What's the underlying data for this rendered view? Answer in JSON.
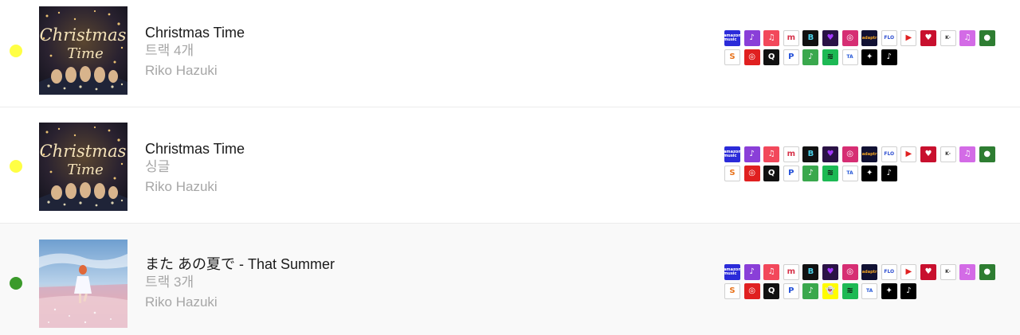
{
  "releases": [
    {
      "title": "Christmas Time",
      "subtitle": "트랙 4개",
      "artist": "Riko Hazuki",
      "status_color": "#ffff44",
      "cover": "christmas-cover",
      "cover_text": [
        "Christmas",
        "Time"
      ],
      "stores": [
        "amazon-music",
        "audiomack",
        "apple-music",
        "melon",
        "boomplay",
        "deezer",
        "instagram",
        "adaptr",
        "flo",
        "youtube-music",
        "iheartradio",
        "kkbox",
        "itunes",
        "napster",
        "anghami",
        "netease",
        "qobuz",
        "pandora",
        "jiosaavn",
        "spotify",
        "tidal-alt",
        "tidal",
        "tiktok"
      ]
    },
    {
      "title": "Christmas Time",
      "subtitle": "싱글",
      "artist": "Riko Hazuki",
      "status_color": "#ffff44",
      "cover": "christmas-cover",
      "cover_text": [
        "Christmas",
        "Time"
      ],
      "stores": [
        "amazon-music",
        "audiomack",
        "apple-music",
        "melon",
        "boomplay",
        "deezer",
        "instagram",
        "adaptr",
        "flo",
        "youtube-music",
        "iheartradio",
        "kkbox",
        "itunes",
        "napster",
        "anghami",
        "netease",
        "qobuz",
        "pandora",
        "jiosaavn",
        "spotify",
        "tidal-alt",
        "tidal",
        "tiktok"
      ]
    },
    {
      "title": "また あの夏で - That Summer",
      "subtitle": "트랙 3개",
      "artist": "Riko Hazuki",
      "status_color": "#3a9a2a",
      "cover": "summer-beach-cover",
      "stores": [
        "amazon-music",
        "audiomack",
        "apple-music",
        "melon",
        "boomplay",
        "deezer",
        "instagram",
        "adaptr",
        "flo",
        "youtube-music",
        "iheartradio",
        "kkbox",
        "itunes",
        "napster",
        "anghami",
        "netease",
        "qobuz",
        "pandora",
        "jiosaavn",
        "snapchat",
        "spotify",
        "tidal-alt",
        "tidal",
        "tiktok"
      ]
    }
  ],
  "store_styles": {
    "amazon-music": {
      "bg": "#2b2bd9",
      "fg": "#ffffff",
      "glyph": "amazon music",
      "cls": "xs"
    },
    "audiomack": {
      "bg": "#8a3fd8",
      "fg": "#ffffff",
      "glyph": "♪"
    },
    "apple-music": {
      "bg": "#f2485b",
      "fg": "#ffffff",
      "glyph": "♫"
    },
    "melon": {
      "bg": "#ffffff",
      "fg": "#d6334a",
      "glyph": "m",
      "border": true
    },
    "boomplay": {
      "bg": "#111111",
      "fg": "#4ad0e8",
      "glyph": "B"
    },
    "deezer": {
      "bg": "#2a1245",
      "fg": "#a238ff",
      "glyph": "♥"
    },
    "instagram": {
      "bg": "#d62e73",
      "fg": "#ffffff",
      "glyph": "◎"
    },
    "adaptr": {
      "bg": "#111133",
      "fg": "#f5a623",
      "glyph": "adaptr",
      "cls": "xs"
    },
    "flo": {
      "bg": "#ffffff",
      "fg": "#2f4fd0",
      "glyph": "FLO",
      "cls": "s",
      "border": true
    },
    "youtube-music": {
      "bg": "#ffffff",
      "fg": "#e02020",
      "glyph": "▶",
      "border": true
    },
    "iheartradio": {
      "bg": "#c8102e",
      "fg": "#ffffff",
      "glyph": "♥"
    },
    "kkbox": {
      "bg": "#ffffff",
      "fg": "#333333",
      "glyph": "K·",
      "cls": "s",
      "border": true
    },
    "itunes": {
      "bg": "#d36be6",
      "fg": "#ffffff",
      "glyph": "♫"
    },
    "napster": {
      "bg": "#2e7d32",
      "fg": "#ffffff",
      "glyph": "●"
    },
    "anghami": {
      "bg": "#ffffff",
      "fg": "#e8731c",
      "glyph": "S",
      "border": true
    },
    "netease": {
      "bg": "#e02020",
      "fg": "#ffffff",
      "glyph": "◎"
    },
    "qobuz": {
      "bg": "#111111",
      "fg": "#ffffff",
      "glyph": "Q"
    },
    "pandora": {
      "bg": "#ffffff",
      "fg": "#2450d8",
      "glyph": "P",
      "border": true
    },
    "jiosaavn": {
      "bg": "#3aa84d",
      "fg": "#ffffff",
      "glyph": "♪"
    },
    "snapchat": {
      "bg": "#fffc00",
      "fg": "#ffffff",
      "glyph": "👻"
    },
    "spotify": {
      "bg": "#1db954",
      "fg": "#111111",
      "glyph": "≋"
    },
    "tidal-alt": {
      "bg": "#ffffff",
      "fg": "#2a5bd8",
      "glyph": "TA",
      "cls": "s",
      "border": true
    },
    "tidal": {
      "bg": "#000000",
      "fg": "#ffffff",
      "glyph": "✦"
    },
    "tiktok": {
      "bg": "#000000",
      "fg": "#ffffff",
      "glyph": "♪"
    }
  }
}
